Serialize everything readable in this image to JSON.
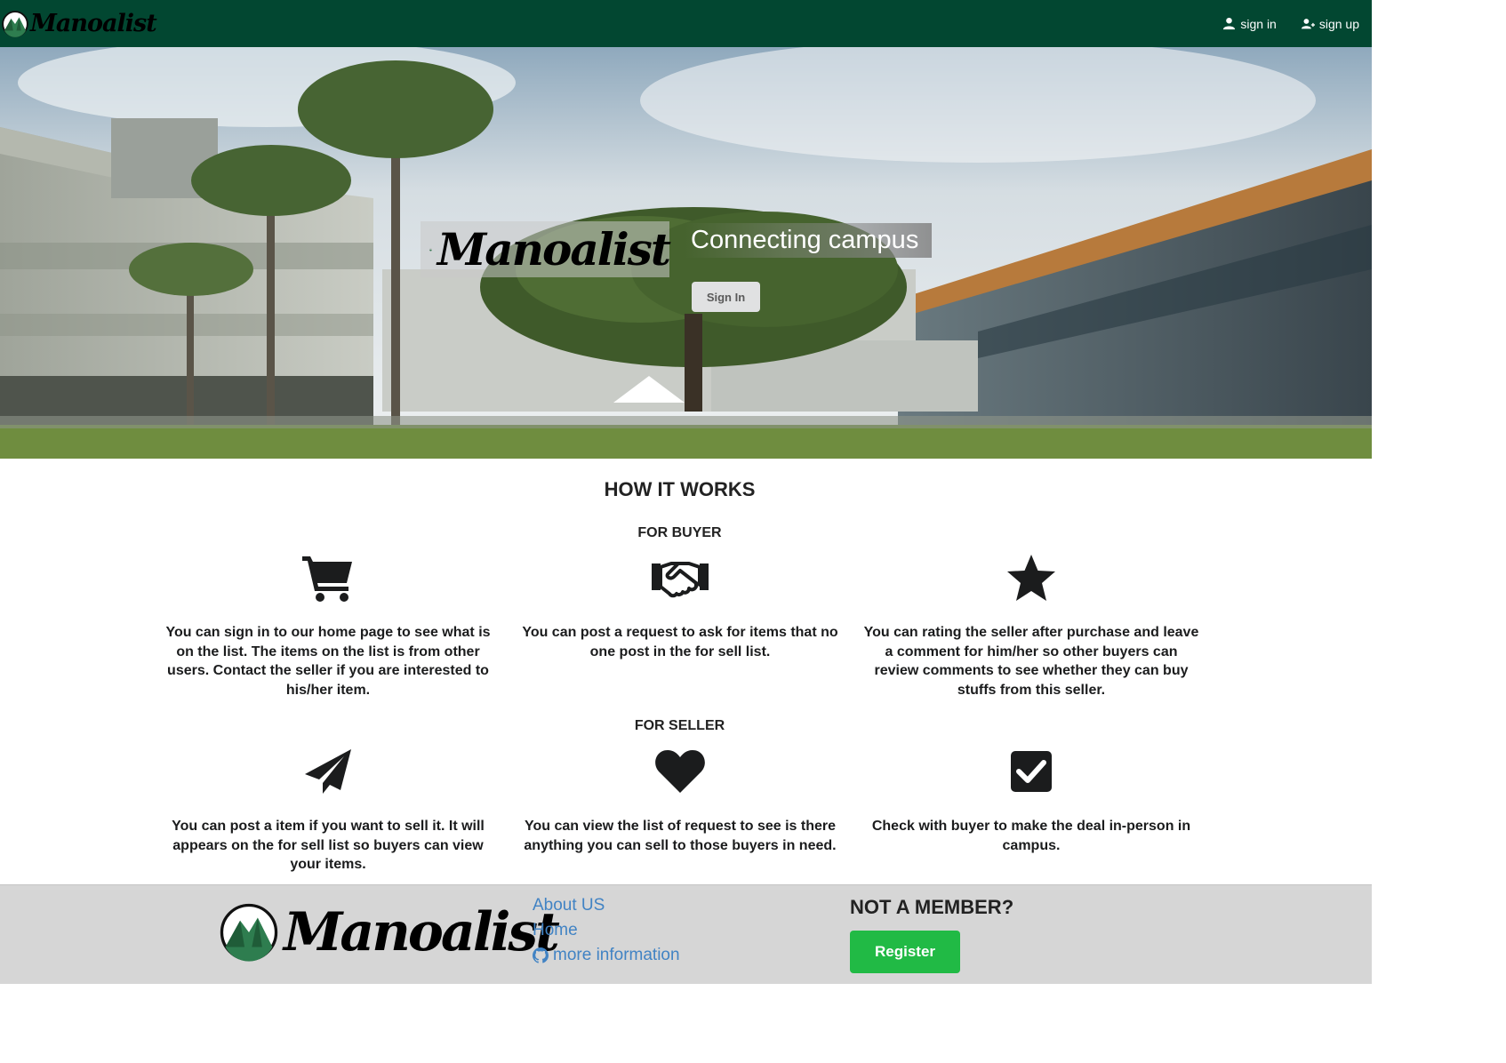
{
  "nav": {
    "logo_text": "Manoalist",
    "sign_in": "sign in",
    "sign_up": "sign up"
  },
  "hero": {
    "logo_text": "Manoalist",
    "tagline": "Connecting campus",
    "sign_in_button": "Sign In"
  },
  "how": {
    "title": "HOW IT WORKS",
    "buyer_title": "FOR BUYER",
    "seller_title": "FOR SELLER",
    "buyer": [
      {
        "icon": "shopping-cart-icon",
        "text": "You can sign in to our home page to see what is on the list. The items on the list is from other users. Contact the seller if you are interested to his/her item."
      },
      {
        "icon": "handshake-icon",
        "text": "You can post a request to ask for items that no one post in the for sell list."
      },
      {
        "icon": "star-icon",
        "text": "You can rating the seller after purchase and leave a comment for him/her so other buyers can review comments to see whether they can buy stuffs from this seller."
      }
    ],
    "seller": [
      {
        "icon": "paper-plane-icon",
        "text": "You can post a item if you want to sell it. It will appears on the for sell list so buyers can view your items."
      },
      {
        "icon": "heart-icon",
        "text": "You can view the list of request to see is there anything you can sell to those buyers in need."
      },
      {
        "icon": "check-square-icon",
        "text": "Check with buyer to make the deal in-person in campus."
      }
    ]
  },
  "footer": {
    "logo_text": "Manoalist",
    "about": "About US",
    "home": "Home",
    "more_info": "more information",
    "not_member": "NOT A MEMBER?",
    "register": "Register"
  },
  "colors": {
    "nav_bg": "#024731",
    "footer_bg": "#d6d6d6",
    "link": "#4183c4",
    "register": "#21ba45"
  }
}
